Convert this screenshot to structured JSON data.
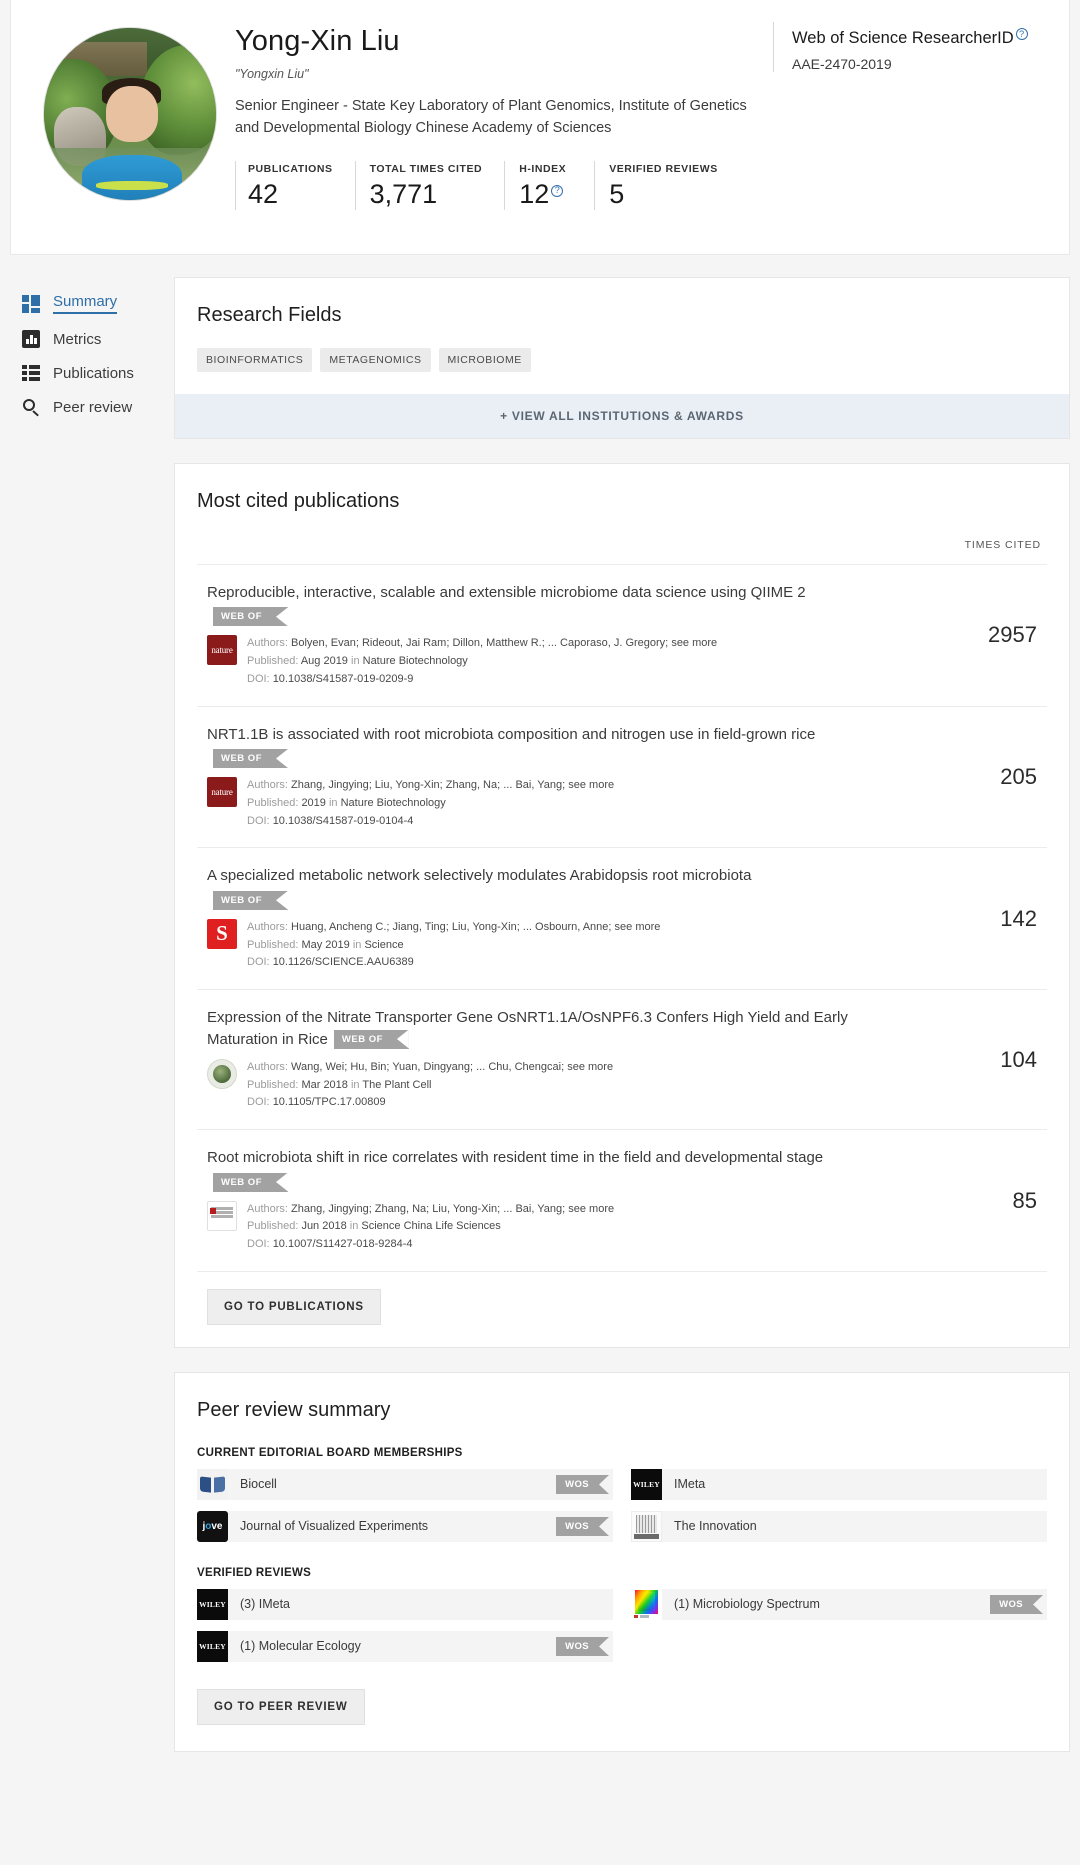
{
  "profile": {
    "name": "Yong-Xin Liu",
    "alt_name": "\"Yongxin Liu\"",
    "affiliation": "Senior Engineer - State Key Laboratory of Plant Genomics, Institute of Genetics and Developmental Biology Chinese Academy of Sciences",
    "researcher_id_title": "Web of Science ResearcherID",
    "researcher_id_value": "AAE-2470-2019",
    "metrics": [
      {
        "label": "PUBLICATIONS",
        "value": "42",
        "help": false
      },
      {
        "label": "TOTAL TIMES CITED",
        "value": "3,771",
        "help": false
      },
      {
        "label": "H-INDEX",
        "value": "12",
        "help": true
      },
      {
        "label": "VERIFIED REVIEWS",
        "value": "5",
        "help": false
      }
    ]
  },
  "sidebar": {
    "items": [
      {
        "label": "Summary",
        "icon": "grid-icon",
        "active": true
      },
      {
        "label": "Metrics",
        "icon": "bar-chart-icon",
        "active": false
      },
      {
        "label": "Publications",
        "icon": "list-icon",
        "active": false
      },
      {
        "label": "Peer review",
        "icon": "search-icon",
        "active": false
      }
    ]
  },
  "research_fields": {
    "title": "Research Fields",
    "chips": [
      "BIOINFORMATICS",
      "METAGENOMICS",
      "MICROBIOME"
    ],
    "view_all_label": "+ VIEW ALL INSTITUTIONS & AWARDS"
  },
  "most_cited": {
    "title": "Most cited publications",
    "times_cited_header": "TIMES CITED",
    "go_to_publications_label": "GO TO PUBLICATIONS",
    "badge_label": "WEB OF",
    "authors_label": "Authors:",
    "published_label": "Published:",
    "doi_label": "DOI:",
    "see_more_label": "see more",
    "in_label": "in",
    "rows": [
      {
        "title": "Reproducible, interactive, scalable and extensible microbiome data science using QIIME 2",
        "authors": "Bolyen, Evan; Rideout, Jai Ram; Dillon, Matthew R.; ...  Caporaso, J. Gregory;",
        "published_date": "Aug 2019",
        "journal": "Nature Biotechnology",
        "doi": "10.1038/S41587-019-0209-9",
        "times_cited": "2957",
        "logo": "nature",
        "title_inline_badge": false
      },
      {
        "title": "NRT1.1B is associated with root microbiota composition and nitrogen use in field-grown rice",
        "authors": "Zhang, Jingying; Liu, Yong-Xin; Zhang, Na; ...  Bai, Yang;",
        "published_date": "2019",
        "journal": "Nature Biotechnology",
        "doi": "10.1038/S41587-019-0104-4",
        "times_cited": "205",
        "logo": "nature",
        "title_inline_badge": false
      },
      {
        "title": "A specialized metabolic network selectively modulates Arabidopsis root microbiota",
        "authors": "Huang, Ancheng C.; Jiang, Ting; Liu, Yong-Xin; ...  Osbourn, Anne;",
        "published_date": "May 2019",
        "journal": "Science",
        "doi": "10.1126/SCIENCE.AAU6389",
        "times_cited": "142",
        "logo": "science",
        "title_inline_badge": false
      },
      {
        "title": "Expression of the Nitrate Transporter Gene OsNRT1.1A/OsNPF6.3 Confers High Yield and Early Maturation in Rice",
        "authors": "Wang, Wei; Hu, Bin; Yuan, Dingyang; ...  Chu, Chengcai;",
        "published_date": "Mar 2018",
        "journal": "The Plant Cell",
        "doi": "10.1105/TPC.17.00809",
        "times_cited": "104",
        "logo": "plantcell",
        "title_inline_badge": true
      },
      {
        "title": "Root microbiota shift in rice correlates with resident time in the field and developmental stage",
        "authors": "Zhang, Jingying; Zhang, Na; Liu, Yong-Xin; ...  Bai, Yang;",
        "published_date": "Jun 2018",
        "journal": "Science China Life Sciences",
        "doi": "10.1007/S11427-018-9284-4",
        "times_cited": "85",
        "logo": "scichina",
        "title_inline_badge": false
      }
    ]
  },
  "peer_review": {
    "title": "Peer review summary",
    "editorial_heading": "CURRENT EDITORIAL BOARD MEMBERSHIPS",
    "verified_heading": "VERIFIED REVIEWS",
    "wos_badge": "WOS",
    "go_to_peer_review_label": "GO TO PEER REVIEW",
    "editorial": [
      {
        "name": "Biocell",
        "logo": "biocell",
        "wos": true
      },
      {
        "name": "IMeta",
        "logo": "wiley",
        "wos": false
      },
      {
        "name": "Journal of Visualized Experiments",
        "logo": "jove",
        "wos": true
      },
      {
        "name": "The Innovation",
        "logo": "elsevier",
        "wos": false
      }
    ],
    "verified": [
      {
        "name": "(3) IMeta",
        "logo": "wiley",
        "wos": false
      },
      {
        "name": "(1) Microbiology Spectrum",
        "logo": "spectrum",
        "wos": true
      },
      {
        "name": "(1) Molecular Ecology",
        "logo": "wiley",
        "wos": true
      }
    ]
  }
}
